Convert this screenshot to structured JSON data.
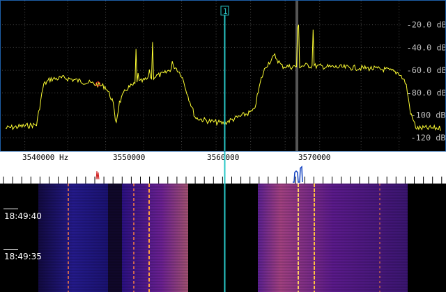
{
  "spectrum": {
    "db_labels": [
      "-20.0 dB",
      "-40.0 dB",
      "-60.0 dB",
      "-80.0 dB",
      "-100 dB",
      "-120 dB"
    ],
    "trace_color": "#ffff33",
    "grid_color": "#555555"
  },
  "scale": {
    "freq_labels": [
      "3540000 Hz",
      "3550000",
      "3560000",
      "3570000"
    ]
  },
  "marker": {
    "label": "1",
    "color": "#29c7c7"
  },
  "waterfall": {
    "timestamps": [
      "18:49:40",
      "18:49:35"
    ]
  }
}
